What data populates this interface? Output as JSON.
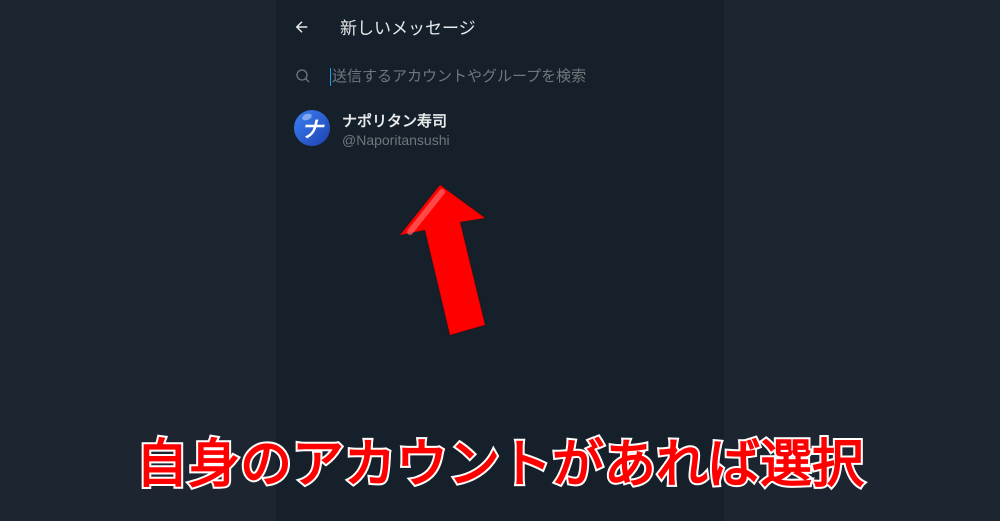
{
  "header": {
    "title": "新しいメッセージ"
  },
  "search": {
    "placeholder": "送信するアカウントやグループを検索"
  },
  "accounts": [
    {
      "display_name": "ナポリタン寿司",
      "handle": "@Naporitansushi",
      "avatar_letter": "ナ"
    }
  ],
  "caption": "自身のアカウントがあれば選択",
  "colors": {
    "background_outer": "#1d2630",
    "background_inner": "#15202b",
    "text_primary": "#e7e9ea",
    "text_secondary": "#71767b",
    "accent_red": "#ff0000"
  }
}
